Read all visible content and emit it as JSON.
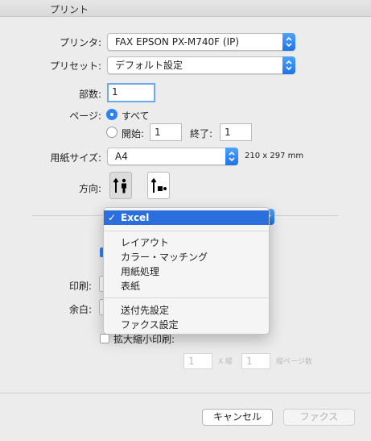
{
  "window": {
    "title": "プリント"
  },
  "printer": {
    "label": "プリンタ:",
    "value": "FAX EPSON PX-M740F (IP)"
  },
  "preset": {
    "label": "プリセット:",
    "value": "デフォルト設定"
  },
  "copies": {
    "label": "部数:",
    "value": "1"
  },
  "pages": {
    "label": "ページ:",
    "all_label": "すべて",
    "from_label": "開始:",
    "from_value": "1",
    "to_label": "終了:",
    "to_value": "1"
  },
  "paper_size": {
    "label": "用紙サイズ:",
    "value": "A4",
    "dimensions": "210 x 297 mm"
  },
  "orientation": {
    "label": "方向:"
  },
  "section_menu": {
    "selected": "Excel",
    "check": "✓",
    "group1": [
      "レイアウト",
      "カラー・マッチング",
      "用紙処理",
      "表紙"
    ],
    "group2": [
      "送付先設定",
      "ファクス設定"
    ]
  },
  "behind": {
    "print_label": "印刷:",
    "margin_label": "余白:",
    "scale_label": "拡大縮小印刷:",
    "scale_x_value": "1",
    "scale_x_label": "X 縦",
    "scale_y_value": "1",
    "scale_y_label": "縦ページ数"
  },
  "buttons": {
    "cancel": "キャンセル",
    "fax": "ファクス"
  },
  "colors": {
    "accent": "#2a83f4",
    "menu_highlight": "#2a6fdb"
  }
}
